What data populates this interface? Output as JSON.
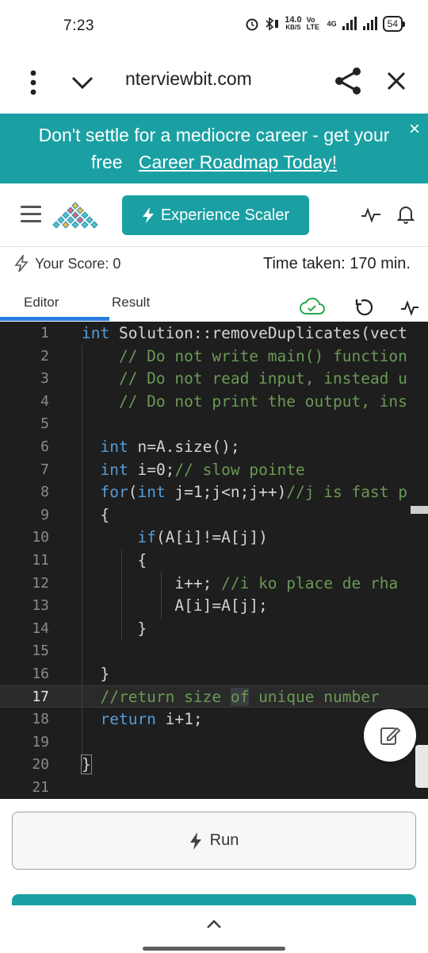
{
  "status_bar": {
    "time": "7:23",
    "net_speed_value": "14.0",
    "net_speed_unit": "KB/S",
    "volte": "Vo LTE",
    "network": "4G",
    "battery": "54"
  },
  "browser": {
    "url": "nterviewbit.com",
    "menu_icon": "more-vert-icon",
    "chevron_icon": "chevron-down-icon",
    "share_icon": "share-icon",
    "close_icon": "close-icon"
  },
  "banner": {
    "line1": "Don't settle for a mediocre career - get your",
    "line2_prefix": "free",
    "cta": "Career Roadmap Today!",
    "close_glyph": "×",
    "bg_color": "#1aa0a3"
  },
  "header": {
    "scaler_button": "Experience Scaler",
    "accent": "#1aa0a3"
  },
  "score": {
    "label": "Your Score: 0",
    "time_taken": "Time taken: 170 min."
  },
  "tabs": [
    {
      "label": "Editor",
      "active": true
    },
    {
      "label": "Result",
      "active": false
    }
  ],
  "editor": {
    "active_line": 17,
    "line_numbers": [
      "1",
      "2",
      "3",
      "4",
      "5",
      "6",
      "7",
      "8",
      "9",
      "10",
      "11",
      "12",
      "13",
      "14",
      "15",
      "16",
      "17",
      "18",
      "19",
      "20",
      "21"
    ],
    "lines": [
      "int Solution::removeDuplicates(vect",
      "    // Do not write main() function",
      "    // Do not read input, instead u",
      "    // Do not print the output, ins",
      "",
      "  int n=A.size();",
      "  int i=0;// slow pointe",
      "  for(int j=1;j<n;j++)//j is fast p",
      "  {",
      "      if(A[i]!=A[j])",
      "      {",
      "          i++; //i ko place de rha",
      "          A[i]=A[j];",
      "      }",
      "",
      "  }",
      "  //return size of unique number",
      "  return i+1;",
      "",
      "}",
      ""
    ]
  },
  "run": {
    "label": "Run"
  }
}
